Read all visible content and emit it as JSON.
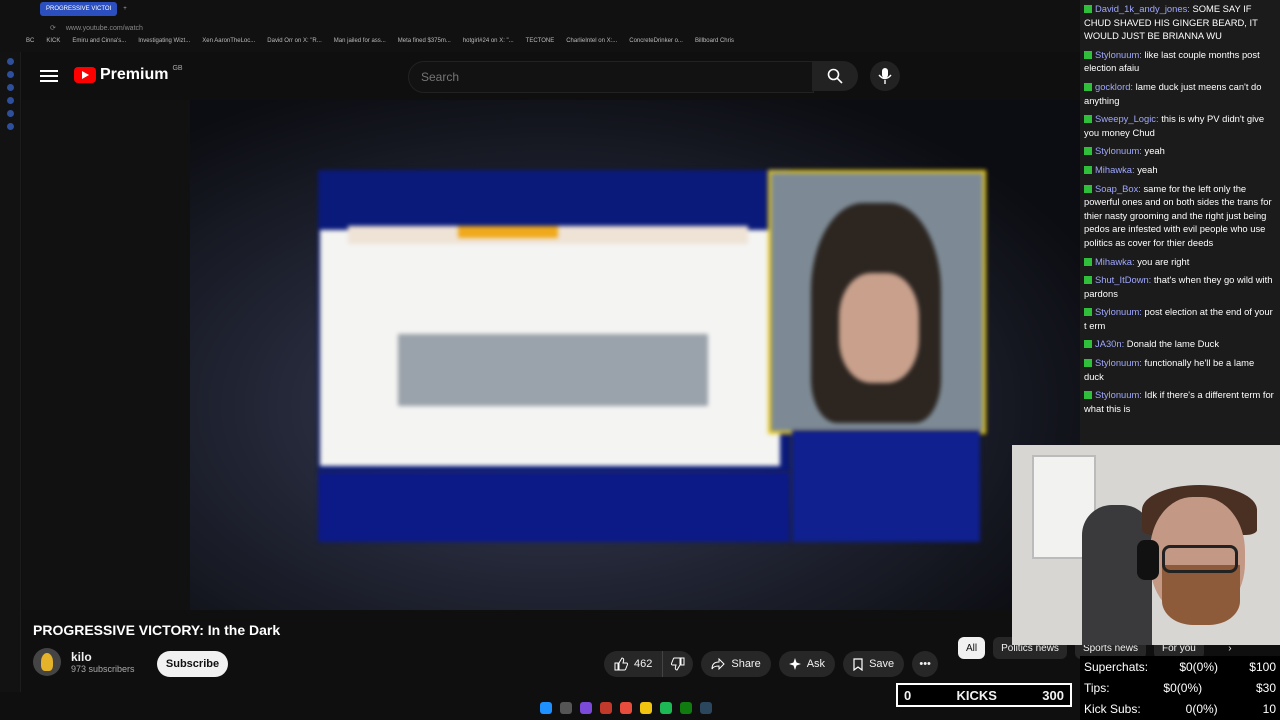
{
  "browser": {
    "tab_title": "PROGRESSIVE VICTOI",
    "url": "www.youtube.com/watch",
    "bookmarks": [
      "BC",
      "KICK",
      "Emiru and Cinna's...",
      "Investigating Wizt...",
      "Xen AaronTheLoc...",
      "David Orr on X: \"R...",
      "Man jailed for ass...",
      "Meta fined $375m...",
      "hotgirl#24 on X: \"...",
      "TECTONE",
      "CharlieIntel on X:...",
      "ConcreteDrinker o...",
      "Billboard Chris"
    ]
  },
  "youtube": {
    "logo_text": "Premium",
    "logo_region": "GB",
    "search_placeholder": "Search"
  },
  "video": {
    "title": "PROGRESSIVE VICTORY: In the Dark",
    "channel_name": "kilo",
    "subscribers": "973 subscribers",
    "subscribe_label": "Subscribe",
    "likes": "462",
    "share_label": "Share",
    "ask_label": "Ask",
    "save_label": "Save"
  },
  "chips": [
    "All",
    "Politics news",
    "Sports news",
    "For you"
  ],
  "chat": [
    {
      "user": "David_1k_andy_jones:",
      "text": "SOME SAY IF CHUD SHAVED HIS GINGER BEARD, IT WOULD JUST BE BRIANNA WU"
    },
    {
      "user": "Stylonuum:",
      "text": "like last couple months post election afaiu"
    },
    {
      "user": "gocklord:",
      "text": "lame duck just meens can't do anything"
    },
    {
      "user": "Sweepy_Logic:",
      "text": "this is why PV didn't give you money Chud"
    },
    {
      "user": "Stylonuum:",
      "text": "yeah"
    },
    {
      "user": "Mihawka:",
      "text": "yeah"
    },
    {
      "user": "Soap_Box:",
      "text": "same for the left only the powerful ones and on both sides the trans for thier nasty grooming and the right just being pedos are infested with evil people who use politics as cover for thier deeds"
    },
    {
      "user": "Mihawka:",
      "text": "you are right"
    },
    {
      "user": "Shut_ItDown:",
      "text": "that's when they go wild with pardons"
    },
    {
      "user": "Stylonuum:",
      "text": "post election at the end of your t erm"
    },
    {
      "user": "JA30n:",
      "text": "Donald the lame Duck"
    },
    {
      "user": "Stylonuum:",
      "text": "functionally he'll be a lame duck"
    },
    {
      "user": "Stylonuum:",
      "text": "Idk if there's a different term for what this is"
    }
  ],
  "stream": {
    "kicks_count": "0",
    "kicks_label": "KICKS",
    "kicks_goal": "300",
    "stats": [
      {
        "label": "Superchats:",
        "value": "$0(0%)",
        "goal": "$100"
      },
      {
        "label": "Tips:",
        "value": "$0(0%)",
        "goal": "$30"
      },
      {
        "label": "Kick Subs:",
        "value": "0(0%)",
        "goal": "10"
      }
    ]
  }
}
